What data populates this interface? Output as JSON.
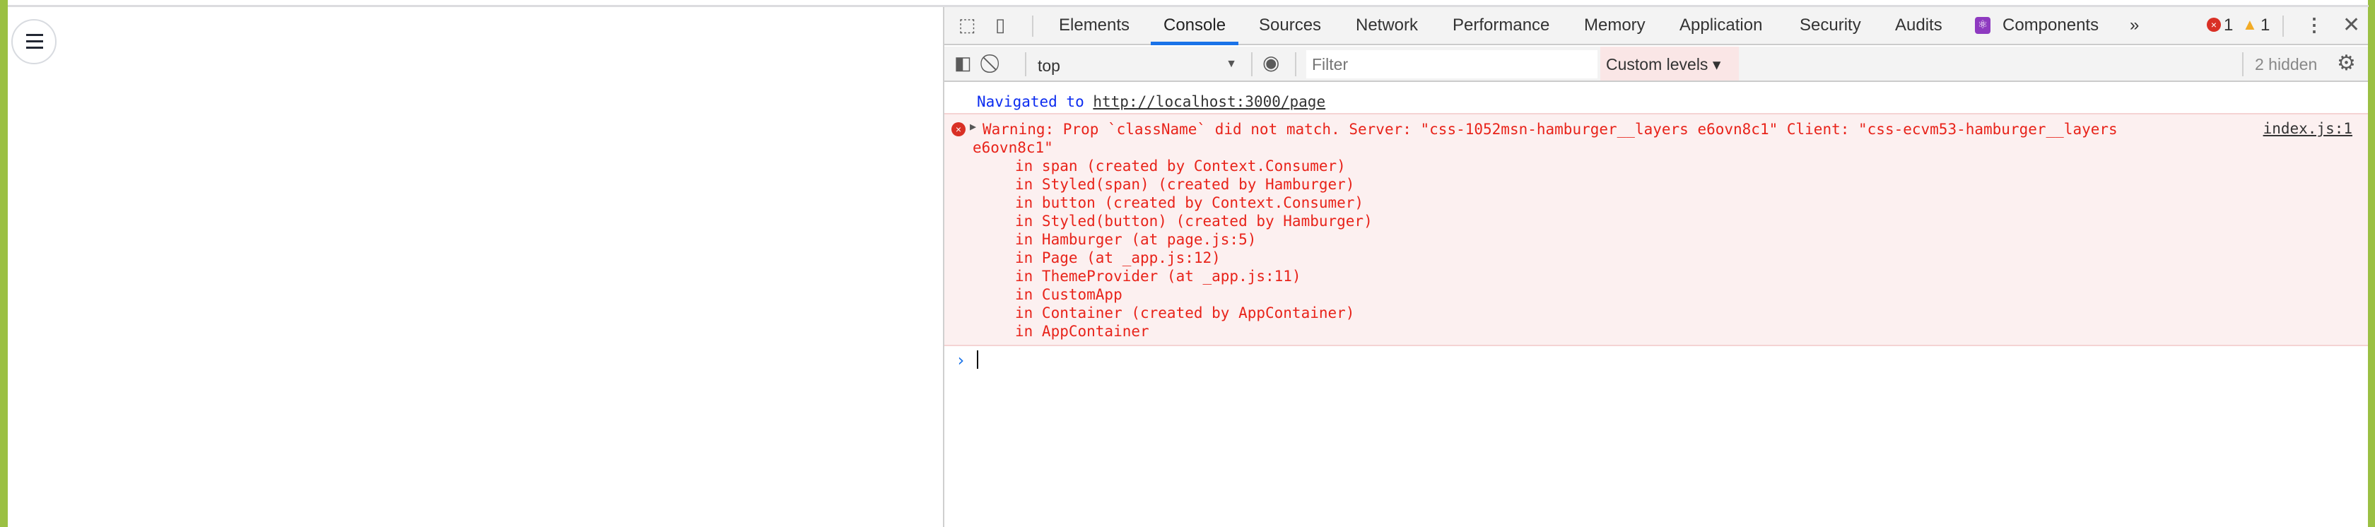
{
  "devtools": {
    "tabs": [
      "Elements",
      "Console",
      "Sources",
      "Network",
      "Performance",
      "Memory",
      "Application",
      "Security",
      "Audits",
      "Components"
    ],
    "active_tab": "Console",
    "more": "»",
    "error_count": "1",
    "warning_count": "1",
    "context": "top",
    "filter_placeholder": "Filter",
    "levels": "Custom levels ▾",
    "hidden": "2 hidden"
  },
  "console": {
    "nav_prefix": "Navigated to",
    "nav_url": "http://localhost:3000/page",
    "warning_line1": "Warning: Prop `className` did not match. Server: \"css-1052msn-hamburger__layers e6ovn8c1\" Client: \"css-ecvm53-hamburger__layers",
    "warning_line2": "e6ovn8c1\"",
    "source": "index.js:1",
    "stack": [
      "in span (created by Context.Consumer)",
      "in Styled(span) (created by Hamburger)",
      "in button (created by Context.Consumer)",
      "in Styled(button) (created by Hamburger)",
      "in Hamburger (at page.js:5)",
      "in Page (at _app.js:12)",
      "in ThemeProvider (at _app.js:11)",
      "in CustomApp",
      "in Container (created by AppContainer)",
      "in AppContainer"
    ],
    "prompt": "›"
  },
  "colors": {
    "accent": "#1a73e8",
    "error": "#e8231a",
    "page_border": "#9bc043"
  }
}
